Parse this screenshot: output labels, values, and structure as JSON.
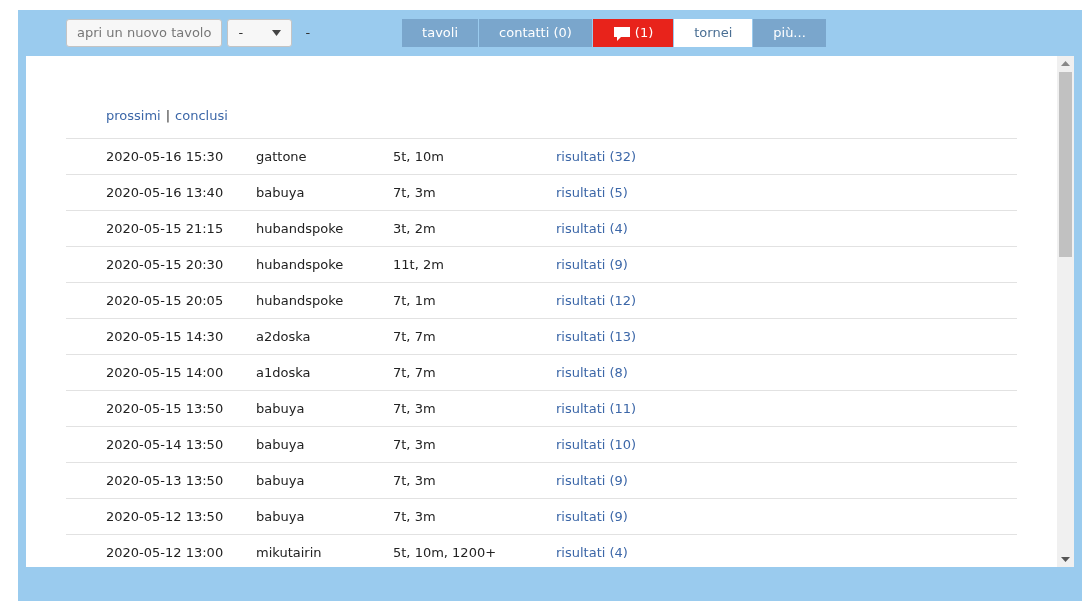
{
  "toolbar": {
    "new_table_button": "apri un nuovo tavolo",
    "select_value": "-",
    "status": "-"
  },
  "tabs": [
    {
      "label": "tavoli",
      "kind": "text",
      "selected": false
    },
    {
      "label": "contatti (0)",
      "kind": "text",
      "selected": false
    },
    {
      "label": "(1)",
      "kind": "chat",
      "selected": false
    },
    {
      "label": "tornei",
      "kind": "text",
      "selected": true
    },
    {
      "label": "più...",
      "kind": "text",
      "selected": false
    }
  ],
  "filters": [
    {
      "label": "prossimi"
    },
    {
      "label": "conclusi"
    }
  ],
  "filter_separator": "|",
  "tournaments": [
    {
      "date": "2020-05-16 15:30",
      "organizer": "gattone",
      "settings": "5t, 10m",
      "results": "risultati (32)"
    },
    {
      "date": "2020-05-16 13:40",
      "organizer": "babuya",
      "settings": "7t, 3m",
      "results": "risultati (5)"
    },
    {
      "date": "2020-05-15 21:15",
      "organizer": "hubandspoke",
      "settings": "3t, 2m",
      "results": "risultati (4)"
    },
    {
      "date": "2020-05-15 20:30",
      "organizer": "hubandspoke",
      "settings": "11t, 2m",
      "results": "risultati (9)"
    },
    {
      "date": "2020-05-15 20:05",
      "organizer": "hubandspoke",
      "settings": "7t, 1m",
      "results": "risultati (12)"
    },
    {
      "date": "2020-05-15 14:30",
      "organizer": "a2doska",
      "settings": "7t, 7m",
      "results": "risultati (13)"
    },
    {
      "date": "2020-05-15 14:00",
      "organizer": "a1doska",
      "settings": "7t, 7m",
      "results": "risultati (8)"
    },
    {
      "date": "2020-05-15 13:50",
      "organizer": "babuya",
      "settings": "7t, 3m",
      "results": "risultati (11)"
    },
    {
      "date": "2020-05-14 13:50",
      "organizer": "babuya",
      "settings": "7t, 3m",
      "results": "risultati (10)"
    },
    {
      "date": "2020-05-13 13:50",
      "organizer": "babuya",
      "settings": "7t, 3m",
      "results": "risultati (9)"
    },
    {
      "date": "2020-05-12 13:50",
      "organizer": "babuya",
      "settings": "7t, 3m",
      "results": "risultati (9)"
    },
    {
      "date": "2020-05-12 13:00",
      "organizer": "mikutairin",
      "settings": "5t, 10m, 1200+",
      "results": "risultati (4)"
    }
  ]
}
